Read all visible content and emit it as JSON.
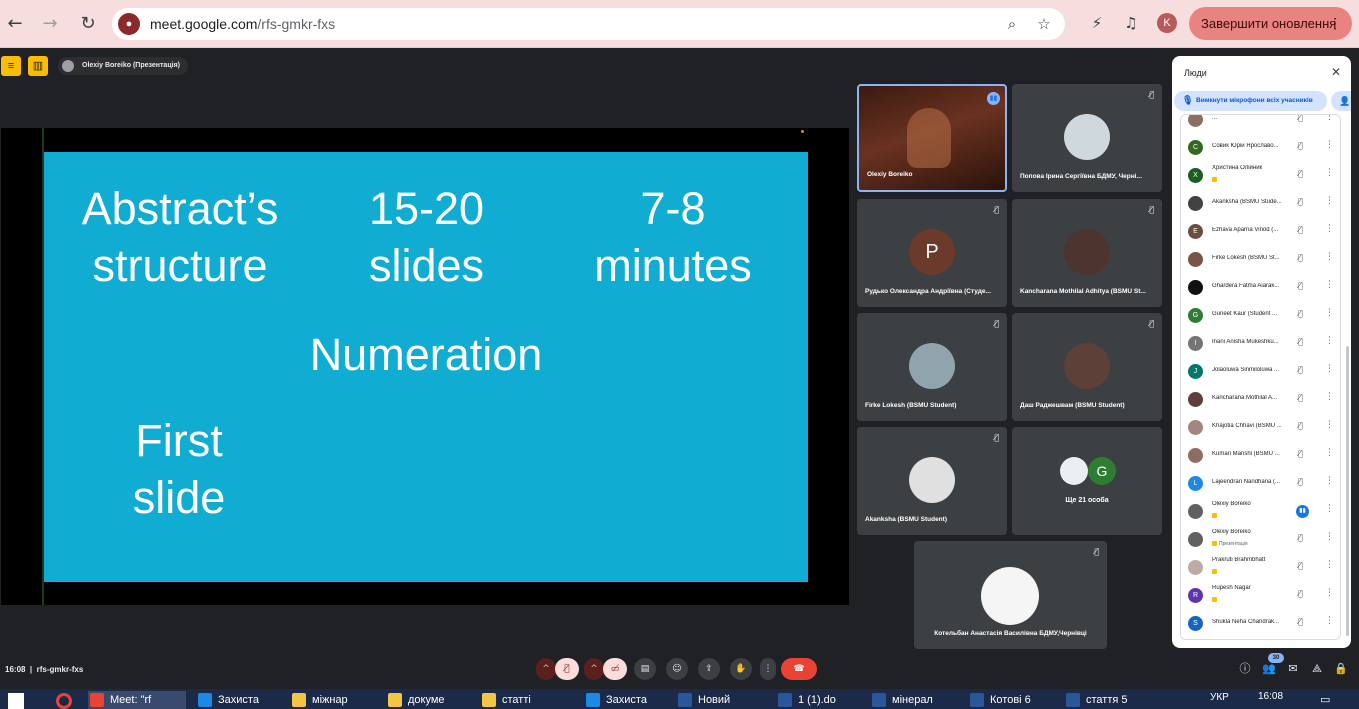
{
  "browser": {
    "url_host": "meet.google.com",
    "url_path": "/rfs-gmkr-fxs",
    "profile_initial": "K",
    "update_label": "Завершити оновлення",
    "icons": [
      "back-icon",
      "forward-icon",
      "reload-icon",
      "site-info-icon",
      "zoom-icon",
      "bookmark-star-icon",
      "extension-icon",
      "media-controls-icon",
      "menu-dots-icon"
    ]
  },
  "meet": {
    "presenter_chip": "Olexiy Boreiko (Презентація)",
    "meeting_time": "16:08",
    "meeting_code": "rfs-gmkr-fxs",
    "participants_count": "30"
  },
  "slide": {
    "col1_line1": "Abstract’s",
    "col1_line2": "structure",
    "col2_line1": "15-20",
    "col2_line2": "slides",
    "col3_line1": "7-8",
    "col3_line2": "minutes",
    "center": "Numeration",
    "bottom_line1": "First",
    "bottom_line2": "slide",
    "background": "#10acd1"
  },
  "tiles": [
    {
      "name": "Olexiy Boreiko"
    },
    {
      "name": "Попова Ірина Сергіївна БДМУ, Черні..."
    },
    {
      "name": "Рудько Олександра Андріївна (Студе...",
      "initial": "P"
    },
    {
      "name": "Kancharana Mothilal Adhitya (BSMU St..."
    },
    {
      "name": "Firke Lokesh (BSMU Student)"
    },
    {
      "name": "Даш Раджешвам (BSMU Student)"
    },
    {
      "name": "Akanksha (BSMU Student)"
    },
    {
      "name": "Ще 21 особа",
      "initial": "G"
    },
    {
      "name": "Котельбан Анастасія Василівна БДМУ,Чернівці"
    }
  ],
  "panel": {
    "title": "Люди",
    "mute_all": "Вимкнути мікрофони всіх учасників",
    "people": [
      {
        "name": "...",
        "initial": "",
        "color": "#8d6e63"
      },
      {
        "name": "Совик Юрій Ярославо...",
        "initial": "С",
        "color": "#33691e"
      },
      {
        "name": "Христина Олійник",
        "initial": "Х",
        "color": "#1b5e20",
        "sub": true
      },
      {
        "name": "Akanksha (BSMU Stude...",
        "initial": "",
        "color": "#424242"
      },
      {
        "name": "Ezhava Aparna Vinod (...",
        "initial": "E",
        "color": "#6d4c41"
      },
      {
        "name": "Firke Lokesh (BSMU St...",
        "initial": "",
        "color": "#795548"
      },
      {
        "name": "Ghardera Fatma Aiarak...",
        "initial": "",
        "color": "#111111"
      },
      {
        "name": "Guneet Kaur (Student ...",
        "initial": "G",
        "color": "#2e7d32"
      },
      {
        "name": "Inani Anisha Mukeshku...",
        "initial": "I",
        "color": "#757575"
      },
      {
        "name": "Jolaoluwa Sinmiloluwa ...",
        "initial": "J",
        "color": "#00796b"
      },
      {
        "name": "Kancharana Mothilal A...",
        "initial": "",
        "color": "#5d4037"
      },
      {
        "name": "Khajotia Chhavi (BSMU ...",
        "initial": "",
        "color": "#a1887f"
      },
      {
        "name": "Kumari Manshi (BSMU ...",
        "initial": "",
        "color": "#8d6e63"
      },
      {
        "name": "Lajeendran Nandhana (...",
        "initial": "L",
        "color": "#1e88e5"
      },
      {
        "name": "Olexiy Boreiko",
        "initial": "",
        "color": "#616161",
        "sub": true,
        "speaking": true
      },
      {
        "name": "Olexiy Boreiko",
        "initial": "",
        "color": "#616161",
        "sub": true,
        "subtext": "Презентація"
      },
      {
        "name": "Prakruti Brahmbhatt",
        "initial": "",
        "color": "#bcaaa4",
        "sub": true
      },
      {
        "name": "Rupesh Nagar",
        "initial": "R",
        "color": "#5e35b1",
        "sub": true
      },
      {
        "name": "Shukla Neha Chandrak...",
        "initial": "S",
        "color": "#1565c0"
      }
    ]
  },
  "taskbar": {
    "items": [
      {
        "label": "Meet: \"rf",
        "color": "#ea4335"
      },
      {
        "label": "Захиста",
        "color": "#1e88e5"
      },
      {
        "label": "міжнар",
        "color": "#f4c542"
      },
      {
        "label": "докуме",
        "color": "#f4c542"
      },
      {
        "label": "статті",
        "color": "#f4c542"
      },
      {
        "label": "Захиста",
        "color": "#1e88e5"
      },
      {
        "label": "Новий",
        "color": "#2b579a"
      },
      {
        "label": "1 (1).do",
        "color": "#2b579a"
      },
      {
        "label": "мінерал",
        "color": "#2b579a"
      },
      {
        "label": "Котові 6",
        "color": "#2b579a"
      },
      {
        "label": "стаття 5",
        "color": "#2b579a"
      }
    ],
    "lang": "УКР",
    "clock": "16:08"
  }
}
